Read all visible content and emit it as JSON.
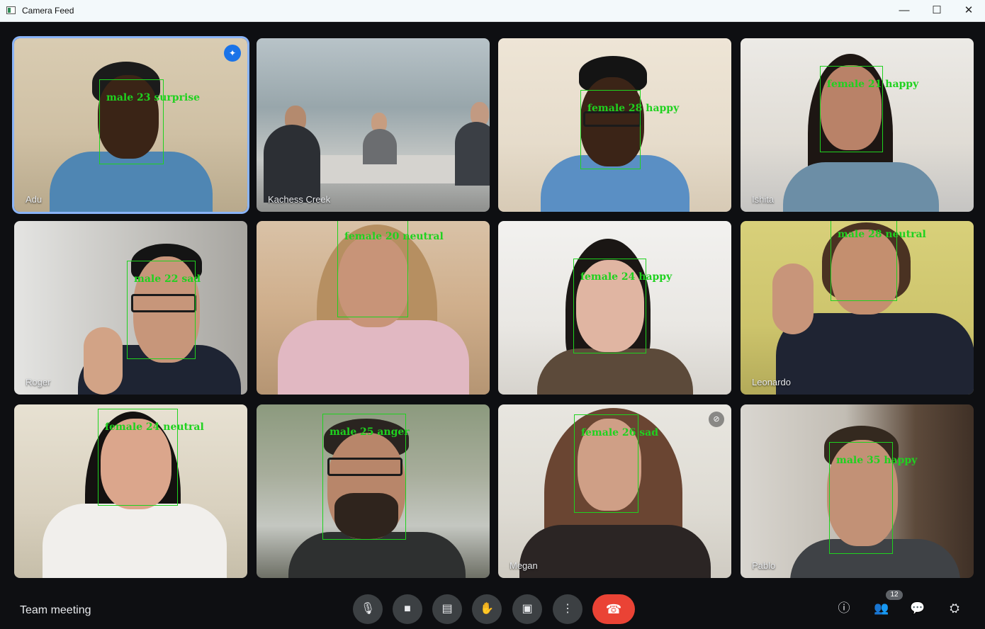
{
  "window": {
    "title": "Camera Feed",
    "minimize": "—",
    "maximize": "☐",
    "close": "✕"
  },
  "tiles": [
    {
      "name": "Adu",
      "detection": "male 23 surprise"
    },
    {
      "name": "Kachess Creek",
      "detection": ""
    },
    {
      "name": "",
      "detection": "female 28 happy"
    },
    {
      "name": "Ishita",
      "detection": "female 21 happy"
    },
    {
      "name": "Roger",
      "detection": "male 22 sad"
    },
    {
      "name": "",
      "detection": "female 20 neutral"
    },
    {
      "name": "",
      "detection": "female 24 happy"
    },
    {
      "name": "Leonardo",
      "detection": "male 28 neutral"
    },
    {
      "name": "",
      "detection": "female 24 neutral"
    },
    {
      "name": "",
      "detection": "male 25 anger"
    },
    {
      "name": "Megan",
      "detection": "female 26 sad"
    },
    {
      "name": "Pablo",
      "detection": "male 35 happy"
    }
  ],
  "bottom_bar": {
    "meeting_title": "Team meeting",
    "participant_count": "12",
    "controls": {
      "mic_icon": "🎙",
      "camera_icon": "■",
      "captions_icon": "▤",
      "raise_hand_icon": "✋",
      "present_icon": "▣",
      "more_icon": "⋮",
      "end_call_icon": "☎"
    },
    "right_icons": {
      "info_icon": "ⓘ",
      "people_icon": "👥",
      "chat_icon": "💬",
      "activities_icon": "⛭"
    }
  },
  "colors": {
    "detection_green": "#1fd21f",
    "end_call_red": "#ea4335",
    "active_speaker_blue": "#8ab4f8"
  }
}
